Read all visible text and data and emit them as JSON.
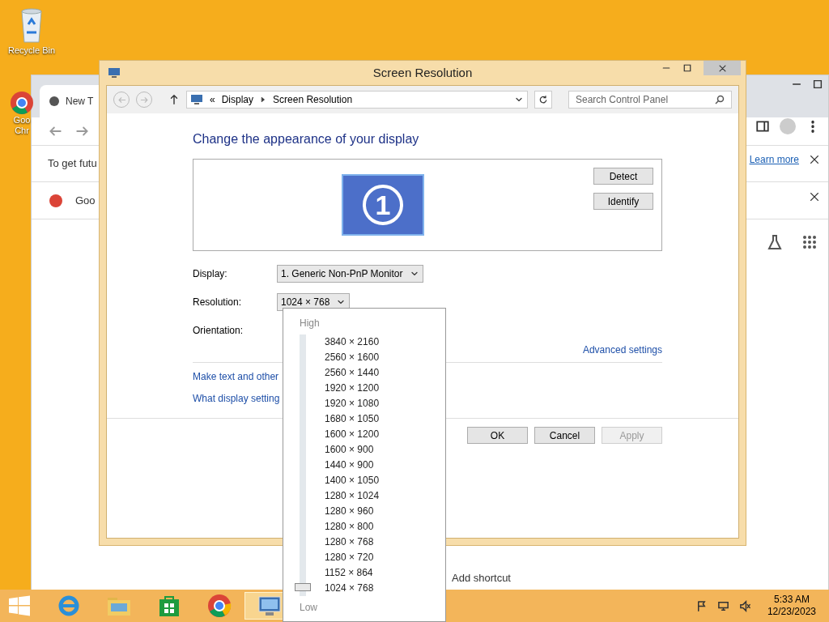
{
  "desktop": {
    "icons": [
      {
        "label": "Recycle Bin"
      },
      {
        "label": "Goo Chr"
      }
    ]
  },
  "browser": {
    "tab": "New T",
    "notice": "To get futu",
    "notice_link": "Learn more",
    "search_row": "Goo",
    "shortcut": "Add shortcut"
  },
  "window": {
    "title": "Screen Resolution",
    "breadcrumb": [
      "Display",
      "Screen Resolution"
    ],
    "breadcrumb_prefix": "«",
    "search": {
      "placeholder": "Search Control Panel"
    },
    "heading": "Change the appearance of your display",
    "monitor_number": "1",
    "buttons_side": [
      "Detect",
      "Identify"
    ],
    "fields": [
      {
        "label": "Display:",
        "value": "1. Generic Non-PnP Monitor"
      },
      {
        "label": "Resolution:",
        "value": "1024 × 768"
      },
      {
        "label": "Orientation:"
      }
    ],
    "advanced_link": "Advanced settings",
    "links": [
      "Make text and other",
      "What display setting"
    ],
    "buttons": [
      {
        "label": "OK",
        "disabled": false
      },
      {
        "label": "Cancel",
        "disabled": false
      },
      {
        "label": "Apply",
        "disabled": true
      }
    ]
  },
  "dropdown": {
    "high": "High",
    "low": "Low",
    "level": 0,
    "options": [
      "3840 × 2160",
      "2560 × 1600",
      "2560 × 1440",
      "1920 × 1200",
      "1920 × 1080",
      "1680 × 1050",
      "1600 × 1200",
      "1600 × 900",
      "1440 × 900",
      "1400 × 1050",
      "1280 × 1024",
      "1280 × 960",
      "1280 × 800",
      "1280 × 768",
      "1280 × 720",
      "1152 × 864",
      "1024 × 768"
    ]
  },
  "taskbar": {
    "time": "5:33 AM",
    "date": "12/23/2023",
    "items": [
      {
        "kind": "ie",
        "active": false
      },
      {
        "kind": "explorer",
        "active": false
      },
      {
        "kind": "store",
        "active": false
      },
      {
        "kind": "chrome",
        "active": false
      },
      {
        "kind": "control",
        "active": true
      }
    ]
  }
}
